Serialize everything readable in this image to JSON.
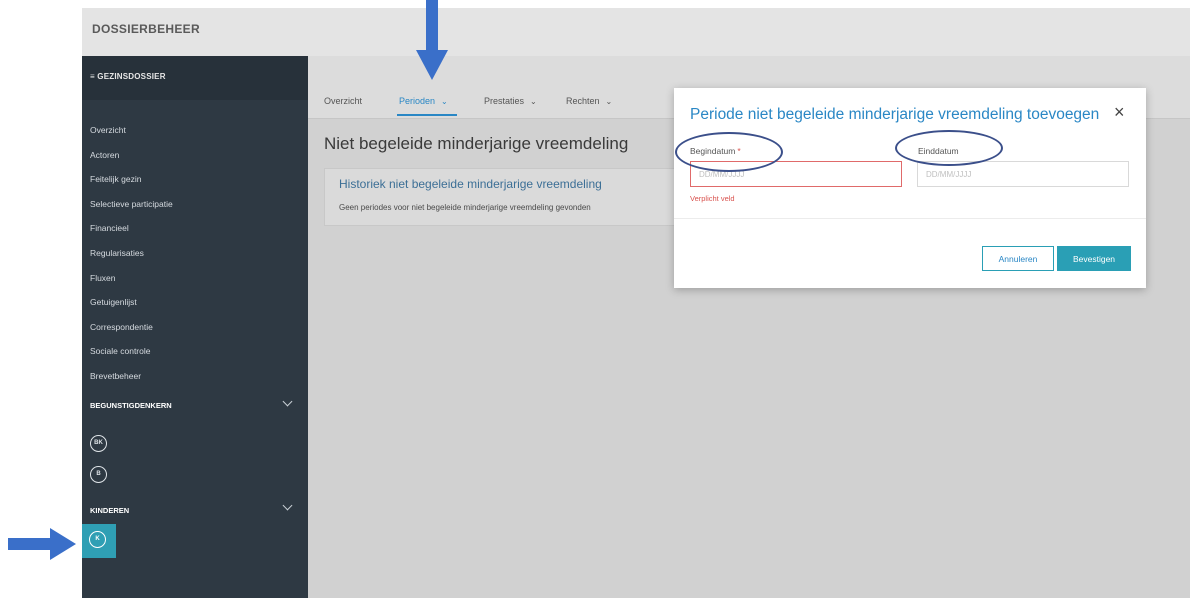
{
  "app": {
    "title": "DOSSIERBEHEER"
  },
  "sidebar": {
    "header": "≡ GEZINSDOSSIER",
    "items": [
      {
        "label": "Overzicht"
      },
      {
        "label": "Actoren"
      },
      {
        "label": "Feitelijk gezin"
      },
      {
        "label": "Selectieve participatie"
      },
      {
        "label": "Financieel"
      },
      {
        "label": "Regularisaties"
      },
      {
        "label": "Fluxen"
      },
      {
        "label": "Getuigenlijst"
      },
      {
        "label": "Correspondentie"
      },
      {
        "label": "Sociale controle"
      },
      {
        "label": "Brevetbeheer"
      }
    ],
    "section_beneficiaries": "BEGUNSTIGDENKERN",
    "beneficiaries": [
      {
        "initials": "BK"
      },
      {
        "initials": "B"
      }
    ],
    "section_children": "KINDEREN",
    "children": [
      {
        "initials": "K"
      }
    ]
  },
  "tabs": [
    {
      "label": "Overzicht",
      "dropdown": false
    },
    {
      "label": "Perioden",
      "dropdown": true,
      "active": true
    },
    {
      "label": "Prestaties",
      "dropdown": true
    },
    {
      "label": "Rechten",
      "dropdown": true
    }
  ],
  "main": {
    "title": "Niet begeleide minderjarige vreemdeling",
    "card": {
      "title": "Historiek niet begeleide minderjarige vreemdeling",
      "text": "Geen periodes voor niet begeleide minderjarige vreemdeling gevonden"
    }
  },
  "modal": {
    "title": "Periode niet begeleide minderjarige vreemdeling toevoegen",
    "close_icon": "close-icon",
    "start_label": "Begindatum",
    "start_required": "*",
    "start_placeholder": "DD/MM/JJJJ",
    "start_error": "Verplicht veld",
    "end_label": "Einddatum",
    "end_placeholder": "DD/MM/JJJJ",
    "cancel_label": "Annuleren",
    "confirm_label": "Bevestigen"
  },
  "colors": {
    "accent": "#2a87c5",
    "sidebar": "#2e3943",
    "active_child": "#2f9fb4",
    "error": "#d9534f",
    "annotation": "#3a6fc9"
  }
}
